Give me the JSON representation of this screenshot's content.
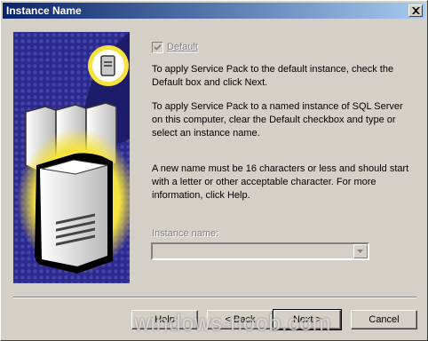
{
  "window": {
    "title": "Instance Name",
    "close_icon": "close-icon"
  },
  "checkbox": {
    "label": "Default",
    "checked": true,
    "enabled": false
  },
  "instructions": {
    "p1": "To apply Service Pack to the default instance,  check the Default box and click Next.",
    "p2": "To apply Service Pack to a named instance of SQL Server on this computer, clear the Default checkbox and type or select an instance name.",
    "p3": "A new name must be 16 characters or less and should start with a letter or other acceptable character.  For more information, click Help."
  },
  "instance": {
    "label": "Instance name:",
    "value": "",
    "enabled": false
  },
  "buttons": {
    "help": "Help",
    "back": "< Back",
    "next": "Next >",
    "cancel": "Cancel"
  },
  "watermark": "windows-noob.com",
  "colors": {
    "title_start": "#0a246a",
    "title_end": "#a6caf0",
    "face": "#d4d0c8",
    "art_blue": "#2b2a8f",
    "art_yellow": "#f5e23a"
  }
}
